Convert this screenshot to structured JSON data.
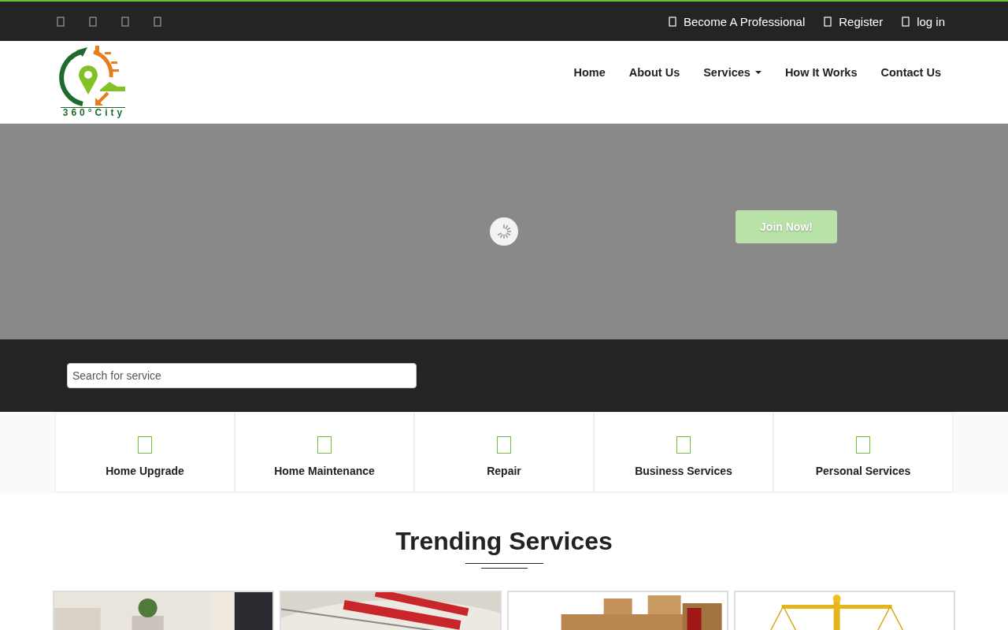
{
  "top_bar": {
    "links": [
      {
        "label": "Become A Professional"
      },
      {
        "label": "Register"
      },
      {
        "label": "log in"
      }
    ]
  },
  "logo": {
    "text": "360°City"
  },
  "nav": [
    {
      "label": "Home",
      "dropdown": false
    },
    {
      "label": "About Us",
      "dropdown": false
    },
    {
      "label": "Services",
      "dropdown": true
    },
    {
      "label": "How It Works",
      "dropdown": false
    },
    {
      "label": "Contact Us",
      "dropdown": false
    }
  ],
  "hero": {
    "loading": true,
    "button": "Join Now!"
  },
  "search": {
    "placeholder": "Search for service"
  },
  "categories": [
    {
      "label": "Home Upgrade"
    },
    {
      "label": "Home Maintenance"
    },
    {
      "label": "Repair"
    },
    {
      "label": "Business Services"
    },
    {
      "label": "Personal Services"
    }
  ],
  "trending": {
    "title": "Trending Services"
  }
}
